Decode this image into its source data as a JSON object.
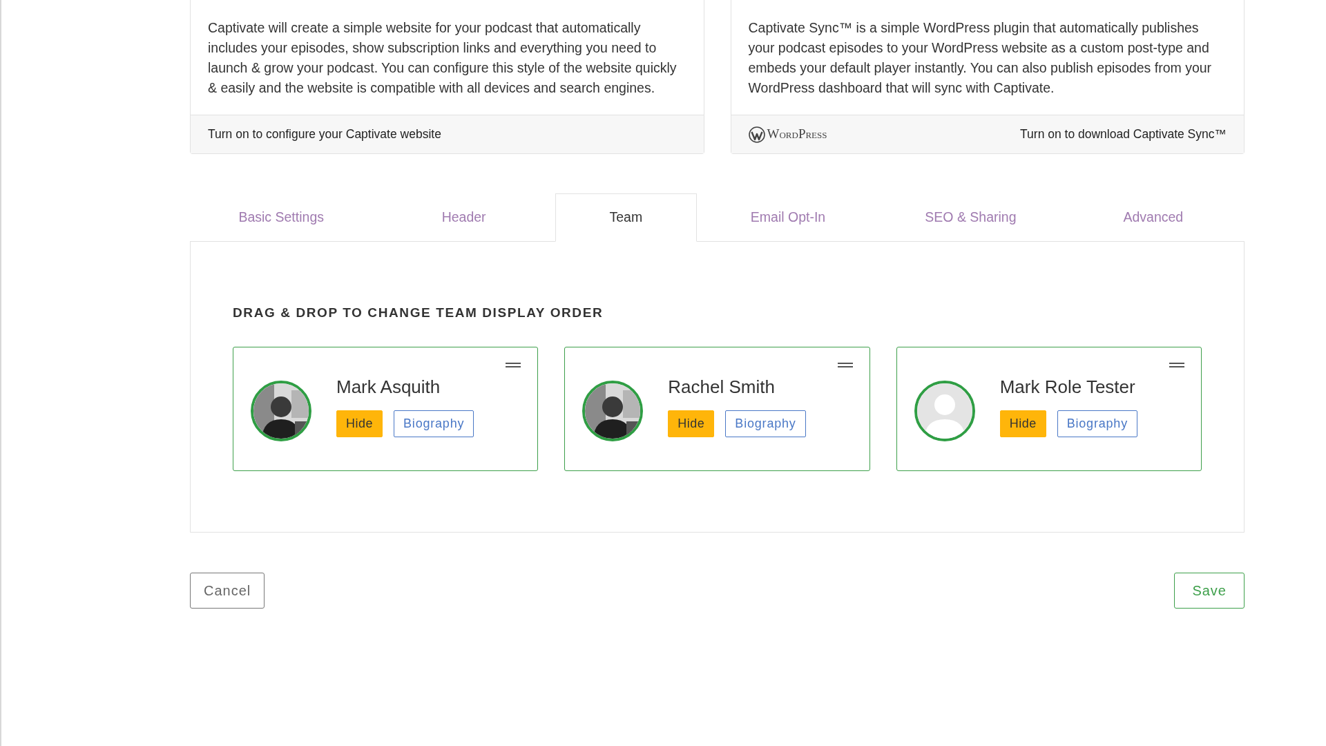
{
  "site_cards": [
    {
      "description": "Captivate will create a simple website for your podcast that automatically includes your episodes, show subscription links and everything you need to launch & grow your podcast. You can configure this style of the website quickly & easily and the website is compatible with all devices and search engines.",
      "footer": {
        "text": "Turn on to configure your Captivate website"
      }
    },
    {
      "description": "Captivate Sync™ is a simple WordPress plugin that automatically publishes your podcast episodes to your WordPress website as a custom post-type and embeds your default player instantly. You can also publish episodes from your WordPress dashboard that will sync with Captivate.",
      "footer": {
        "logo_text": "WordPress",
        "text": "Turn on to download Captivate Sync™"
      }
    }
  ],
  "tabs": [
    {
      "label": "Basic Settings",
      "selected": false
    },
    {
      "label": "Header",
      "selected": false
    },
    {
      "label": "Team",
      "selected": true
    },
    {
      "label": "Email Opt-In",
      "selected": false
    },
    {
      "label": "SEO & Sharing",
      "selected": false
    },
    {
      "label": "Advanced",
      "selected": false
    }
  ],
  "team": {
    "heading": "DRAG & DROP TO CHANGE TEAM DISPLAY ORDER",
    "members": [
      {
        "name": "Mark Asquith",
        "hide_label": "Hide",
        "bio_label": "Biography"
      },
      {
        "name": "Rachel Smith",
        "hide_label": "Hide",
        "bio_label": "Biography"
      },
      {
        "name": "Mark Role Tester",
        "avatar": {
          "kind": "placeholder"
        },
        "hide_label": "Hide",
        "bio_label": "Biography"
      }
    ]
  },
  "actions": {
    "cancel": "Cancel",
    "save": "Save"
  }
}
